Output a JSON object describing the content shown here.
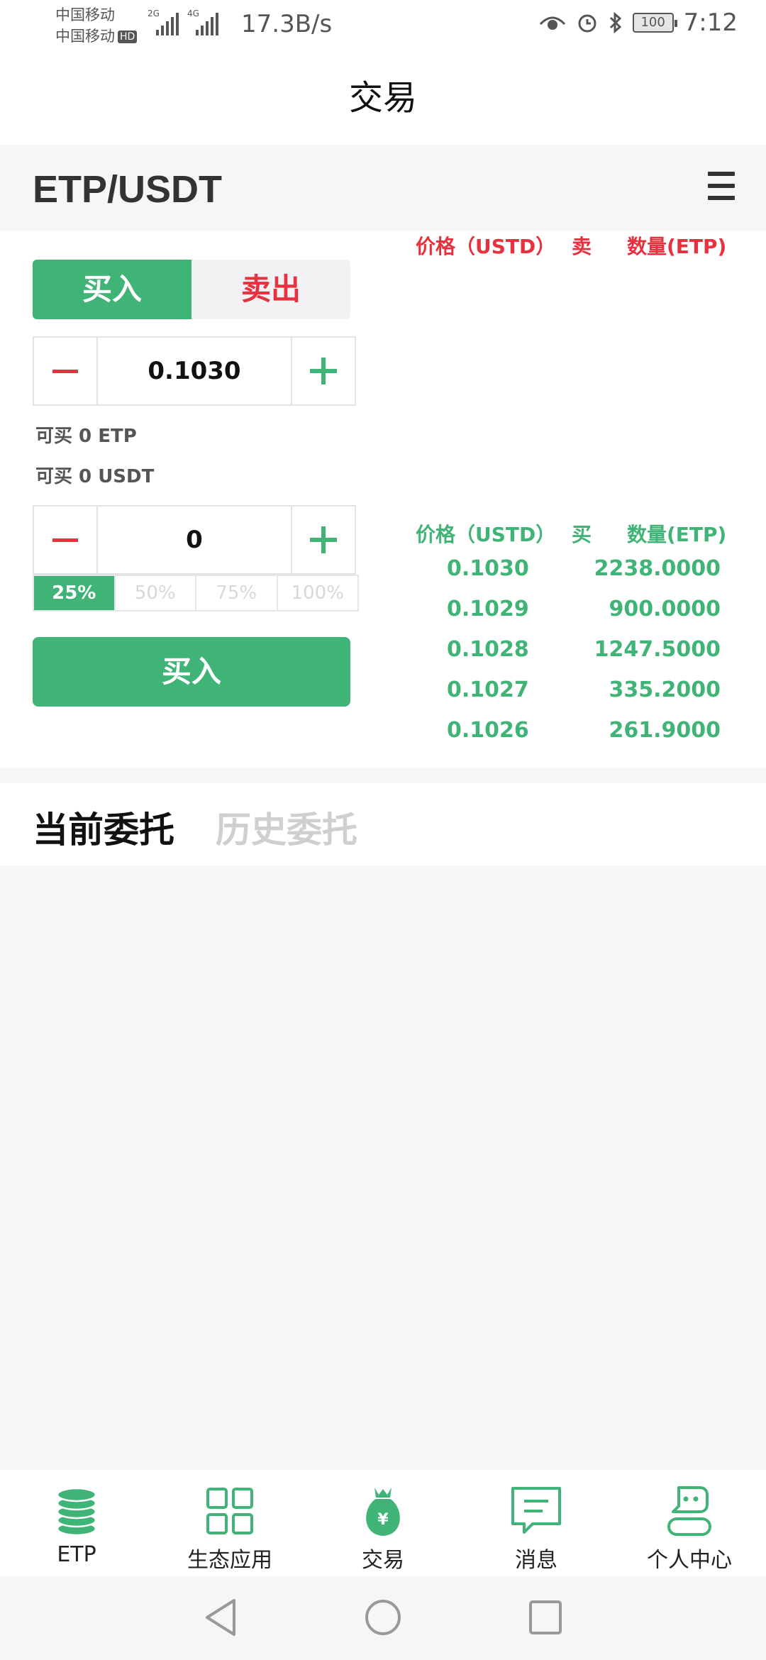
{
  "status_bar": {
    "carrier1": "中国移动",
    "carrier2": "中国移动",
    "hd": "HD",
    "net1": "2G",
    "net2": "4G",
    "speed": "17.3B/s",
    "battery": "100",
    "time": "7:12"
  },
  "header": {
    "title": "交易"
  },
  "pair": {
    "name": "ETP/USDT",
    "menu_icon": "hamburger-menu-icon"
  },
  "trade_form": {
    "tab_buy": "买入",
    "tab_sell": "卖出",
    "price_value": "0.1030",
    "avail_etp": "可买 0 ETP",
    "avail_usdt": "可买 0 USDT",
    "amount_value": "0",
    "percents": [
      "25%",
      "50%",
      "75%",
      "100%"
    ],
    "active_percent": "25%",
    "submit_label": "买入"
  },
  "order_book": {
    "sell_header": {
      "price": "价格（USTD）",
      "side": "卖",
      "qty": "数量(ETP)"
    },
    "buy_header": {
      "price": "价格（USTD）",
      "side": "买",
      "qty": "数量(ETP)"
    },
    "buy_rows": [
      {
        "price": "0.1030",
        "qty": "2238.0000"
      },
      {
        "price": "0.1029",
        "qty": "900.0000"
      },
      {
        "price": "0.1028",
        "qty": "1247.5000"
      },
      {
        "price": "0.1027",
        "qty": "335.2000"
      },
      {
        "price": "0.1026",
        "qty": "261.9000"
      }
    ]
  },
  "orders": {
    "current_tab": "当前委托",
    "history_tab": "历史委托"
  },
  "bottom_nav": [
    {
      "label": "ETP",
      "icon": "coin-stack-icon"
    },
    {
      "label": "生态应用",
      "icon": "grid-apps-icon"
    },
    {
      "label": "交易",
      "icon": "money-bag-icon"
    },
    {
      "label": "消息",
      "icon": "message-icon"
    },
    {
      "label": "个人中心",
      "icon": "user-icon"
    }
  ],
  "colors": {
    "green": "#3fb476",
    "red": "#e8313e"
  }
}
